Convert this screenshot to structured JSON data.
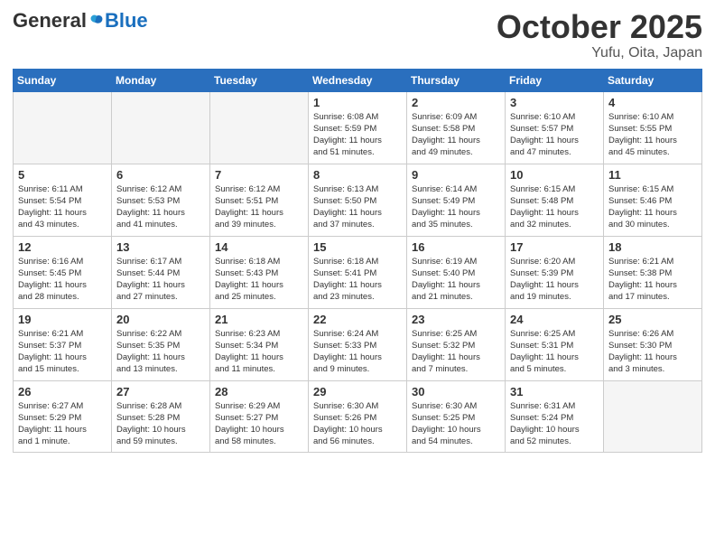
{
  "header": {
    "logo_general": "General",
    "logo_blue": "Blue",
    "month_title": "October 2025",
    "location": "Yufu, Oita, Japan"
  },
  "weekdays": [
    "Sunday",
    "Monday",
    "Tuesday",
    "Wednesday",
    "Thursday",
    "Friday",
    "Saturday"
  ],
  "weeks": [
    [
      {
        "day": "",
        "info": ""
      },
      {
        "day": "",
        "info": ""
      },
      {
        "day": "",
        "info": ""
      },
      {
        "day": "1",
        "info": "Sunrise: 6:08 AM\nSunset: 5:59 PM\nDaylight: 11 hours\nand 51 minutes."
      },
      {
        "day": "2",
        "info": "Sunrise: 6:09 AM\nSunset: 5:58 PM\nDaylight: 11 hours\nand 49 minutes."
      },
      {
        "day": "3",
        "info": "Sunrise: 6:10 AM\nSunset: 5:57 PM\nDaylight: 11 hours\nand 47 minutes."
      },
      {
        "day": "4",
        "info": "Sunrise: 6:10 AM\nSunset: 5:55 PM\nDaylight: 11 hours\nand 45 minutes."
      }
    ],
    [
      {
        "day": "5",
        "info": "Sunrise: 6:11 AM\nSunset: 5:54 PM\nDaylight: 11 hours\nand 43 minutes."
      },
      {
        "day": "6",
        "info": "Sunrise: 6:12 AM\nSunset: 5:53 PM\nDaylight: 11 hours\nand 41 minutes."
      },
      {
        "day": "7",
        "info": "Sunrise: 6:12 AM\nSunset: 5:51 PM\nDaylight: 11 hours\nand 39 minutes."
      },
      {
        "day": "8",
        "info": "Sunrise: 6:13 AM\nSunset: 5:50 PM\nDaylight: 11 hours\nand 37 minutes."
      },
      {
        "day": "9",
        "info": "Sunrise: 6:14 AM\nSunset: 5:49 PM\nDaylight: 11 hours\nand 35 minutes."
      },
      {
        "day": "10",
        "info": "Sunrise: 6:15 AM\nSunset: 5:48 PM\nDaylight: 11 hours\nand 32 minutes."
      },
      {
        "day": "11",
        "info": "Sunrise: 6:15 AM\nSunset: 5:46 PM\nDaylight: 11 hours\nand 30 minutes."
      }
    ],
    [
      {
        "day": "12",
        "info": "Sunrise: 6:16 AM\nSunset: 5:45 PM\nDaylight: 11 hours\nand 28 minutes."
      },
      {
        "day": "13",
        "info": "Sunrise: 6:17 AM\nSunset: 5:44 PM\nDaylight: 11 hours\nand 27 minutes."
      },
      {
        "day": "14",
        "info": "Sunrise: 6:18 AM\nSunset: 5:43 PM\nDaylight: 11 hours\nand 25 minutes."
      },
      {
        "day": "15",
        "info": "Sunrise: 6:18 AM\nSunset: 5:41 PM\nDaylight: 11 hours\nand 23 minutes."
      },
      {
        "day": "16",
        "info": "Sunrise: 6:19 AM\nSunset: 5:40 PM\nDaylight: 11 hours\nand 21 minutes."
      },
      {
        "day": "17",
        "info": "Sunrise: 6:20 AM\nSunset: 5:39 PM\nDaylight: 11 hours\nand 19 minutes."
      },
      {
        "day": "18",
        "info": "Sunrise: 6:21 AM\nSunset: 5:38 PM\nDaylight: 11 hours\nand 17 minutes."
      }
    ],
    [
      {
        "day": "19",
        "info": "Sunrise: 6:21 AM\nSunset: 5:37 PM\nDaylight: 11 hours\nand 15 minutes."
      },
      {
        "day": "20",
        "info": "Sunrise: 6:22 AM\nSunset: 5:35 PM\nDaylight: 11 hours\nand 13 minutes."
      },
      {
        "day": "21",
        "info": "Sunrise: 6:23 AM\nSunset: 5:34 PM\nDaylight: 11 hours\nand 11 minutes."
      },
      {
        "day": "22",
        "info": "Sunrise: 6:24 AM\nSunset: 5:33 PM\nDaylight: 11 hours\nand 9 minutes."
      },
      {
        "day": "23",
        "info": "Sunrise: 6:25 AM\nSunset: 5:32 PM\nDaylight: 11 hours\nand 7 minutes."
      },
      {
        "day": "24",
        "info": "Sunrise: 6:25 AM\nSunset: 5:31 PM\nDaylight: 11 hours\nand 5 minutes."
      },
      {
        "day": "25",
        "info": "Sunrise: 6:26 AM\nSunset: 5:30 PM\nDaylight: 11 hours\nand 3 minutes."
      }
    ],
    [
      {
        "day": "26",
        "info": "Sunrise: 6:27 AM\nSunset: 5:29 PM\nDaylight: 11 hours\nand 1 minute."
      },
      {
        "day": "27",
        "info": "Sunrise: 6:28 AM\nSunset: 5:28 PM\nDaylight: 10 hours\nand 59 minutes."
      },
      {
        "day": "28",
        "info": "Sunrise: 6:29 AM\nSunset: 5:27 PM\nDaylight: 10 hours\nand 58 minutes."
      },
      {
        "day": "29",
        "info": "Sunrise: 6:30 AM\nSunset: 5:26 PM\nDaylight: 10 hours\nand 56 minutes."
      },
      {
        "day": "30",
        "info": "Sunrise: 6:30 AM\nSunset: 5:25 PM\nDaylight: 10 hours\nand 54 minutes."
      },
      {
        "day": "31",
        "info": "Sunrise: 6:31 AM\nSunset: 5:24 PM\nDaylight: 10 hours\nand 52 minutes."
      },
      {
        "day": "",
        "info": ""
      }
    ]
  ]
}
